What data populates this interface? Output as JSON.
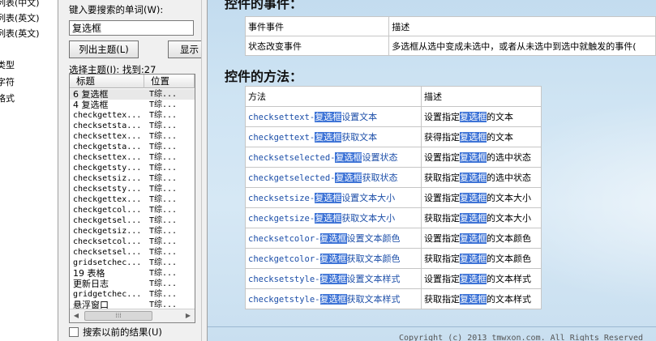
{
  "tree_items": [
    "列表(中文)",
    "列表(英文)",
    "列表(英文)",
    "类型",
    "字符",
    "格式"
  ],
  "search": {
    "label": "键入要搜索的单词(W):",
    "value": "复选框",
    "list_topics_button": "列出主题(L)",
    "display_button": "显示",
    "select_topic_label": "选择主题(I):  找到:27"
  },
  "result_list": {
    "columns": [
      "标题",
      "位置"
    ],
    "rows": [
      {
        "title": "6 复选框",
        "location": "T综..."
      },
      {
        "title": "4 复选框",
        "location": "T综..."
      },
      {
        "title": "checkgettex...",
        "location": "T综..."
      },
      {
        "title": "checksetsta...",
        "location": "T综..."
      },
      {
        "title": "checksettex...",
        "location": "T综..."
      },
      {
        "title": "checkgetsta...",
        "location": "T综..."
      },
      {
        "title": "checksettex...",
        "location": "T综..."
      },
      {
        "title": "checkgetsty...",
        "location": "T综..."
      },
      {
        "title": "checksetsiz...",
        "location": "T综..."
      },
      {
        "title": "checksetsty...",
        "location": "T综..."
      },
      {
        "title": "checkgettex...",
        "location": "T综..."
      },
      {
        "title": "checkgetcol...",
        "location": "T综..."
      },
      {
        "title": "checkgetsel...",
        "location": "T综..."
      },
      {
        "title": "checkgetsiz...",
        "location": "T综..."
      },
      {
        "title": "checksetcol...",
        "location": "T综..."
      },
      {
        "title": "checksetsel...",
        "location": "T综..."
      },
      {
        "title": "gridsetchec...",
        "location": "T综..."
      },
      {
        "title": "19 表格",
        "location": "T综..."
      },
      {
        "title": "更新日志",
        "location": "T综..."
      },
      {
        "title": "gridgetchec...",
        "location": "T综..."
      },
      {
        "title": "悬浮窗口",
        "location": "T综..."
      }
    ]
  },
  "previous_results_label": "搜索以前的结果(U)",
  "content": {
    "events_title": "控件的事件：",
    "events_headers": [
      "事件事件",
      "描述"
    ],
    "events_rows": [
      {
        "name": "状态改变事件",
        "desc": "多选框从选中变成未选中，或者从未选中到选中就触发的事件("
      }
    ],
    "methods_title": "控件的方法：",
    "methods_headers": [
      "方法",
      "描述"
    ],
    "highlight_word": "复选框",
    "methods_rows": [
      {
        "prefix": "checksettext-",
        "suffix": "设置文本",
        "desc_pre": "设置指定",
        "desc_post": "的文本"
      },
      {
        "prefix": "checkgettext-",
        "suffix": "获取文本",
        "desc_pre": "获得指定",
        "desc_post": "的文本"
      },
      {
        "prefix": "checksetselected-",
        "suffix": "设置状态",
        "desc_pre": "设置指定",
        "desc_post": "的选中状态"
      },
      {
        "prefix": "checkgetselected-",
        "suffix": "获取状态",
        "desc_pre": "获取指定",
        "desc_post": "的选中状态"
      },
      {
        "prefix": "checksetsize-",
        "suffix": "设置文本大小",
        "desc_pre": "设置指定",
        "desc_post": "的文本大小"
      },
      {
        "prefix": "checkgetsize-",
        "suffix": "获取文本大小",
        "desc_pre": "获取指定",
        "desc_post": "的文本大小"
      },
      {
        "prefix": "checksetcolor-",
        "suffix": "设置文本颜色",
        "desc_pre": "设置指定",
        "desc_post": "的文本颜色"
      },
      {
        "prefix": "checkgetcolor-",
        "suffix": "获取文本颜色",
        "desc_pre": "获取指定",
        "desc_post": "的文本颜色"
      },
      {
        "prefix": "checksetstyle-",
        "suffix": "设置文本样式",
        "desc_pre": "设置指定",
        "desc_post": "的文本样式"
      },
      {
        "prefix": "checkgetstyle-",
        "suffix": "获取文本样式",
        "desc_pre": "获取指定",
        "desc_post": "的文本样式"
      }
    ],
    "copyright": "Copyright (c) 2013 tmwxon.com. All Rights Reserved"
  },
  "colors": {
    "highlight": "#3d73d6",
    "link": "#1c4ea8",
    "content_bg": "#cfe4f3"
  }
}
